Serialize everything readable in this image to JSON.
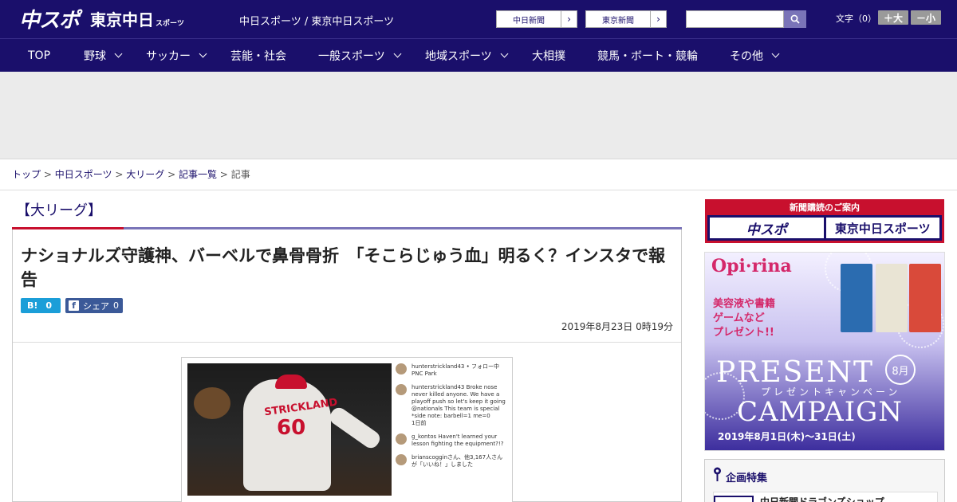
{
  "header": {
    "logo_main": "中スポ",
    "logo_tokyo": "東京中日",
    "logo_tokyo_sub": "スポーツ",
    "sites_link": "中日スポーツ / 東京中日スポーツ",
    "paper_buttons": [
      "中日新聞",
      "東京新聞"
    ],
    "search_placeholder": "",
    "font_size_label": "文字（0）",
    "font_larger": "＋大",
    "font_smaller": "－小"
  },
  "nav": {
    "items": [
      {
        "label": "TOP",
        "dropdown": false
      },
      {
        "label": "野球",
        "dropdown": true
      },
      {
        "label": "サッカー",
        "dropdown": true
      },
      {
        "label": "芸能・社会",
        "dropdown": false
      },
      {
        "label": "一般スポーツ",
        "dropdown": true
      },
      {
        "label": "地域スポーツ",
        "dropdown": true
      },
      {
        "label": "大相撲",
        "dropdown": false
      },
      {
        "label": "競馬・ボート・競輪",
        "dropdown": false
      },
      {
        "label": "その他",
        "dropdown": true
      }
    ]
  },
  "breadcrumb": {
    "items": [
      "トップ",
      "中日スポーツ",
      "大リーグ",
      "記事一覧"
    ],
    "current": "記事",
    "separator": ">"
  },
  "category": "【大リーグ】",
  "article": {
    "headline": "ナショナルズ守護神、バーベルで鼻骨骨折　「そこらじゅう血」明るく？インスタで報告",
    "hatena_label": "B!",
    "hatena_count": "0",
    "fb_label": "シェア",
    "fb_count": "0",
    "date": "2019年8月23日 0時19分",
    "photo": {
      "jersey_name": "STRICKLAND",
      "jersey_number": "60",
      "insta": [
        {
          "user": "hunterstrickland43",
          "text": "• フォロー中",
          "sub": "PNC Park"
        },
        {
          "user": "hunterstrickland43",
          "text": "Broke nose never killed anyone. We have a playoff push so let's keep it going @nationals This team is special *side note: barbell=1 me=0",
          "sub": "1日前"
        },
        {
          "user": "g_kontos",
          "text": "Haven't learned your lesson fighting the equipment?!?",
          "sub": ""
        },
        {
          "user": "brianscoggin",
          "text": "brianscogginさん、他3,167人さんが「いいね！」しました",
          "sub": ""
        }
      ]
    }
  },
  "sidebar": {
    "promo_title": "新聞購読のご案内",
    "promo_tiles": [
      "中スポ",
      "東京中日スポーツ"
    ],
    "ad": {
      "brand": "Opi·rina",
      "lines": [
        "美容液や書籍",
        "ゲームなど",
        "プレゼント!!"
      ],
      "present": "PRESENT",
      "kana": "プレゼントキャンペーン",
      "campaign": "CAMPAIGN",
      "month": "8月",
      "dates": "2019年8月1日(木)〜31日(土)"
    },
    "feature_title": "企画特集",
    "feature_item": "中日新聞ドラゴンズショップ"
  },
  "colors": {
    "brand": "#1a0f6b",
    "accent_red": "#c8102e",
    "accent_purple": "#7a74b8"
  }
}
